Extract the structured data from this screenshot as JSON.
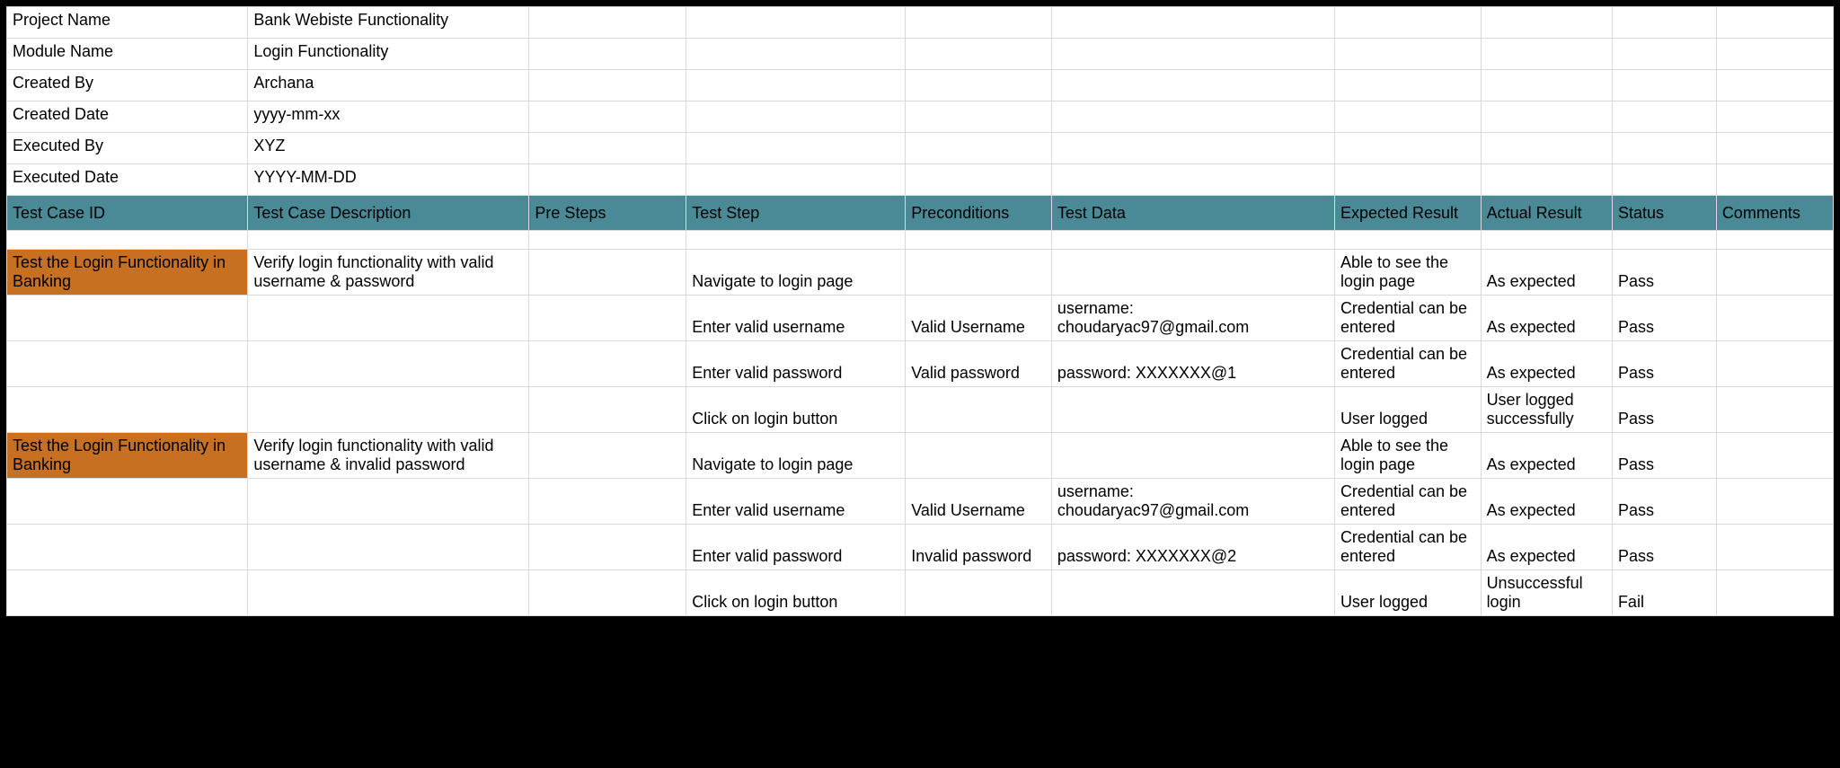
{
  "meta": {
    "rows": [
      {
        "label": "Project Name",
        "value": "Bank Webiste Functionality"
      },
      {
        "label": "Module Name",
        "value": "Login Functionality"
      },
      {
        "label": "Created By",
        "value": "Archana"
      },
      {
        "label": "Created Date",
        "value": "yyyy-mm-xx"
      },
      {
        "label": "Executed By",
        "value": "XYZ"
      },
      {
        "label": "Executed Date",
        "value": "YYYY-MM-DD"
      }
    ]
  },
  "headers": {
    "c1": "Test Case ID",
    "c2": "Test Case Description",
    "c3": "Pre Steps",
    "c4": "Test Step",
    "c5": "Preconditions",
    "c6": "Test Data",
    "c7": "Expected Result",
    "c8": "Actual Result",
    "c9": "Status",
    "c10": "Comments"
  },
  "rows": [
    {
      "case_id": "Test the Login Functionality in Banking",
      "case_id_highlight": true,
      "desc": "Verify login functionality with valid username & password",
      "pre": "",
      "step": "Navigate to login page",
      "precond": "",
      "data": "",
      "expected": "Able to see the login page",
      "actual": "As expected",
      "status": "Pass",
      "comments": ""
    },
    {
      "case_id": "",
      "case_id_highlight": false,
      "desc": "",
      "pre": "",
      "step": "Enter valid username",
      "precond": "Valid Username",
      "data": "username: choudaryac97@gmail.com",
      "expected": "Credential can be entered",
      "actual": "As expected",
      "status": "Pass",
      "comments": ""
    },
    {
      "case_id": "",
      "case_id_highlight": false,
      "desc": "",
      "pre": "",
      "step": "Enter valid password",
      "precond": "Valid password",
      "data": "password: XXXXXXX@1",
      "expected": "Credential can be entered",
      "actual": "As expected",
      "status": "Pass",
      "comments": ""
    },
    {
      "case_id": "",
      "case_id_highlight": false,
      "desc": "",
      "pre": "",
      "step": "Click on login button",
      "precond": "",
      "data": "",
      "expected": "User logged",
      "actual": "User logged successfully",
      "status": "Pass",
      "comments": ""
    },
    {
      "case_id": "Test the Login Functionality in Banking",
      "case_id_highlight": true,
      "desc": "Verify login functionality with valid username & invalid password",
      "pre": "",
      "step": "Navigate to login page",
      "precond": "",
      "data": "",
      "expected": "Able to see the login page",
      "actual": "As expected",
      "status": "Pass",
      "comments": ""
    },
    {
      "case_id": "",
      "case_id_highlight": false,
      "desc": "",
      "pre": "",
      "step": "Enter valid username",
      "precond": "Valid Username",
      "data": "username: choudaryac97@gmail.com",
      "expected": "Credential can be entered",
      "actual": "As expected",
      "status": "Pass",
      "comments": ""
    },
    {
      "case_id": "",
      "case_id_highlight": false,
      "desc": "",
      "pre": "",
      "step": "Enter valid password",
      "precond": "Invalid password",
      "data": "password: XXXXXXX@2",
      "expected": "Credential can be entered",
      "actual": "As expected",
      "status": "Pass",
      "comments": ""
    },
    {
      "case_id": "",
      "case_id_highlight": false,
      "desc": "",
      "pre": "",
      "step": "Click on login button",
      "precond": "",
      "data": "",
      "expected": "User logged",
      "actual": "Unsuccessful login",
      "status": "Fail",
      "comments": ""
    }
  ]
}
